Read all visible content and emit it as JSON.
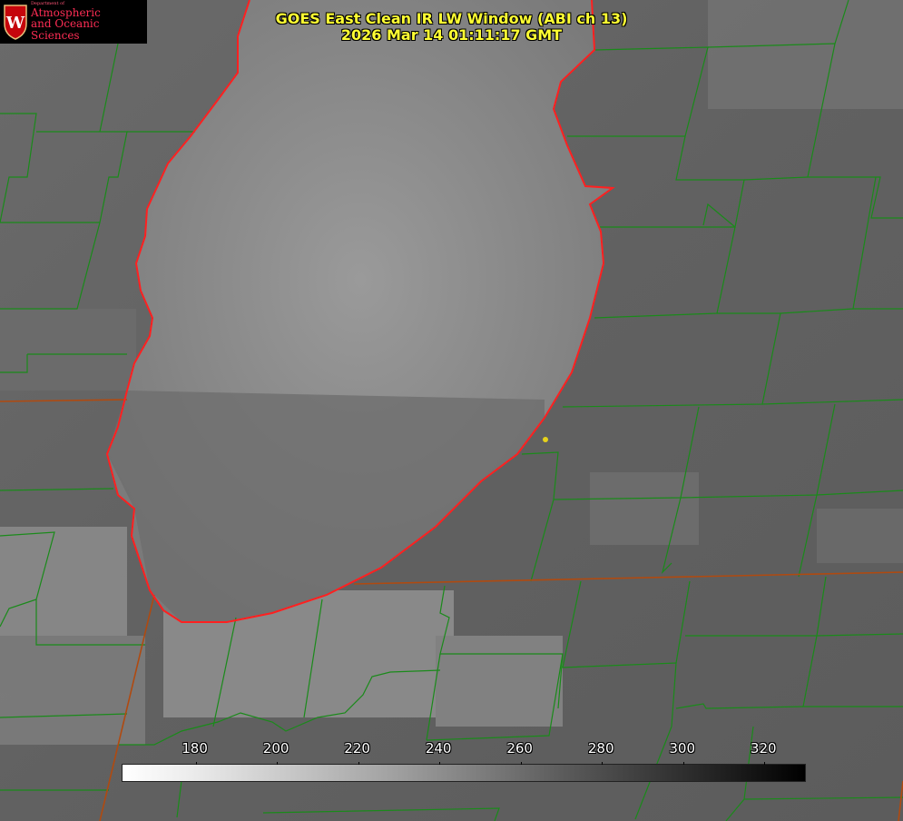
{
  "title_line1": "GOES East Clean IR LW Window (ABI ch 13)",
  "title_line2": "2026 Mar 14 01:11:17 GMT",
  "logo": {
    "department": "Department of",
    "name_line1": "Atmospheric",
    "name_line2": "and Oceanic Sciences",
    "crest_letter": "W"
  },
  "colorbar": {
    "ticks": [
      "180",
      "200",
      "220",
      "240",
      "260",
      "280",
      "300",
      "320"
    ],
    "min": 162,
    "max": 330
  },
  "colors": {
    "title": "#ffff33",
    "lake_shore": "#ff2020",
    "county_lines": "#1a8a1a",
    "state_lines": "#b04a10",
    "marker": "#e6d21a"
  }
}
